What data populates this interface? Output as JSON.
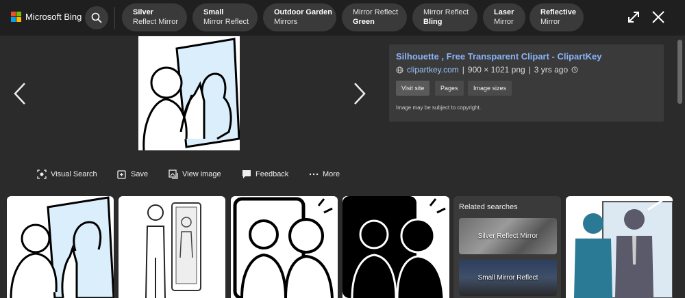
{
  "header": {
    "brand": "Microsoft Bing",
    "chips": [
      {
        "top": "Silver",
        "bottom": "Reflect Mirror",
        "bold_line": "top"
      },
      {
        "top": "Small",
        "bottom": "Mirror Reflect",
        "bold_line": "top"
      },
      {
        "top": "Outdoor Garden",
        "bottom": "Mirrors",
        "bold_line": "top"
      },
      {
        "top": "Mirror Reflect",
        "bottom": "Green",
        "bold_line": "bottom"
      },
      {
        "top": "Mirror Reflect",
        "bottom": "Bling",
        "bold_line": "bottom"
      },
      {
        "top": "Laser",
        "bottom": "Mirror",
        "bold_line": "top"
      },
      {
        "top": "Reflective",
        "bottom": "Mirror",
        "bold_line": "top"
      }
    ]
  },
  "detail": {
    "title": "Silhouette , Free Transparent Clipart - ClipartKey",
    "site": "clipartkey.com",
    "dimensions": "900 × 1021 png",
    "age": "3 yrs ago",
    "buttons": [
      "Visit site",
      "Pages",
      "Image sizes"
    ],
    "copyright": "Image may be subject to copyright."
  },
  "actions": [
    "Visual Search",
    "Save",
    "View image",
    "Feedback",
    "More"
  ],
  "related": {
    "title": "Related searches",
    "items": [
      "Silver Reflect Mirror",
      "Small Mirror Reflect"
    ]
  },
  "colors": {
    "accent_link": "#8ab4f8",
    "background": "#2b2b2b",
    "topbar": "#1f1f1f",
    "chip": "#3a3a3a",
    "teal_figure": "#2a7a96"
  }
}
